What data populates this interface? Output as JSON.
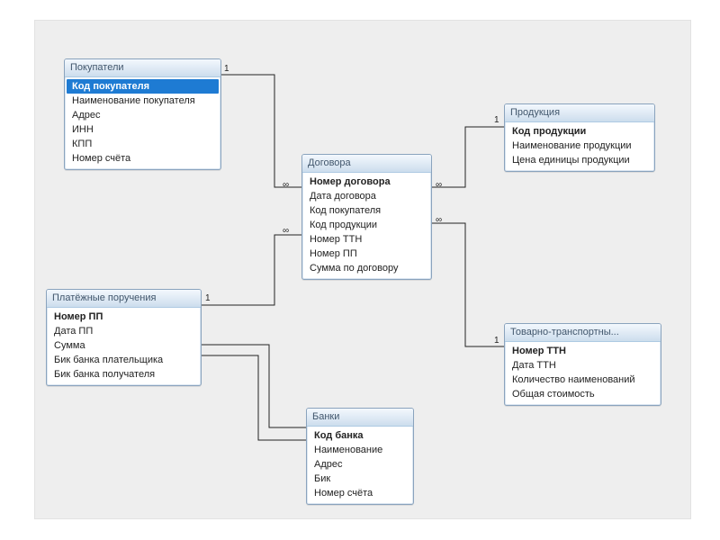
{
  "tables": {
    "buyers": {
      "title": "Покупатели",
      "fields": [
        "Код покупателя",
        "Наименование покупателя",
        "Адрес",
        "ИНН",
        "КПП",
        "Номер счёта"
      ],
      "pk_index": 0,
      "selected_index": 0
    },
    "orders": {
      "title": "Платёжные поручения",
      "fields": [
        "Номер ПП",
        "Дата ПП",
        "Сумма",
        "Бик банка плательщика",
        "Бик банка получателя"
      ],
      "pk_index": 0,
      "selected_index": -1
    },
    "contracts": {
      "title": "Договора",
      "fields": [
        "Номер договора",
        "Дата договора",
        "Код покупателя",
        "Код продукции",
        "Номер ТТН",
        "Номер ПП",
        "Сумма по договору"
      ],
      "pk_index": 0,
      "selected_index": -1
    },
    "products": {
      "title": "Продукция",
      "fields": [
        "Код продукции",
        "Наименование продукции",
        "Цена единицы продукции"
      ],
      "pk_index": 0,
      "selected_index": -1
    },
    "ttn": {
      "title": "Товарно-транспортны...",
      "fields": [
        "Номер ТТН",
        "Дата ТТН",
        "Количество наименований",
        "Общая стоимость"
      ],
      "pk_index": 0,
      "selected_index": -1
    },
    "banks": {
      "title": "Банки",
      "fields": [
        "Код банка",
        "Наименование",
        "Адрес",
        "Бик",
        "Номер счёта"
      ],
      "pk_index": 0,
      "selected_index": -1
    }
  },
  "relationships": [
    {
      "from": "buyers",
      "to": "contracts",
      "from_card": "1",
      "to_card": "∞"
    },
    {
      "from": "orders",
      "to": "contracts",
      "from_card": "1",
      "to_card": "∞"
    },
    {
      "from": "products",
      "to": "contracts",
      "from_card": "1",
      "to_card": "∞"
    },
    {
      "from": "ttn",
      "to": "contracts",
      "from_card": "1",
      "to_card": "∞"
    },
    {
      "from": "orders",
      "to": "banks",
      "from_card": "",
      "to_card": ""
    },
    {
      "from": "orders",
      "to": "banks",
      "from_card": "",
      "to_card": ""
    }
  ]
}
